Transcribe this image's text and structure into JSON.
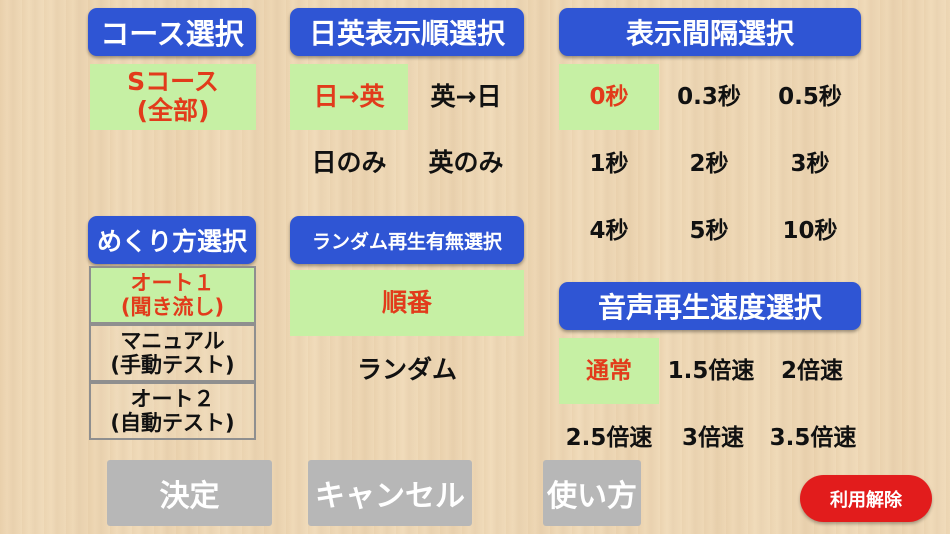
{
  "course": {
    "header": "コース選択",
    "option": {
      "line1": "Sコース",
      "line2": "(全部)"
    }
  },
  "order": {
    "header": "日英表示順選択",
    "options": [
      "日→英",
      "英→日",
      "日のみ",
      "英のみ"
    ]
  },
  "interval": {
    "header": "表示間隔選択",
    "options": [
      "0秒",
      "0.3秒",
      "0.5秒",
      "1秒",
      "2秒",
      "3秒",
      "4秒",
      "5秒",
      "10秒"
    ]
  },
  "flip": {
    "header": "めくり方選択",
    "options": [
      {
        "line1": "オート１",
        "line2": "(聞き流し)"
      },
      {
        "line1": "マニュアル",
        "line2": "(手動テスト)"
      },
      {
        "line1": "オート２",
        "line2": "(自動テスト)"
      }
    ]
  },
  "random": {
    "header": "ランダム再生有無選択",
    "options": [
      "順番",
      "ランダム"
    ]
  },
  "speed": {
    "header": "音声再生速度選択",
    "options": [
      "通常",
      "1.5倍速",
      "2倍速",
      "2.5倍速",
      "3倍速",
      "3.5倍速"
    ]
  },
  "buttons": {
    "decide": "決定",
    "cancel": "キャンセル",
    "howto": "使い方",
    "release": "利用解除"
  },
  "colors": {
    "header_blue": "#2f55d4",
    "selected_bg": "#c6f0a4",
    "selected_text": "#e23b1b",
    "release_red": "#e21c1c",
    "button_gray": "#b7b7b7"
  }
}
